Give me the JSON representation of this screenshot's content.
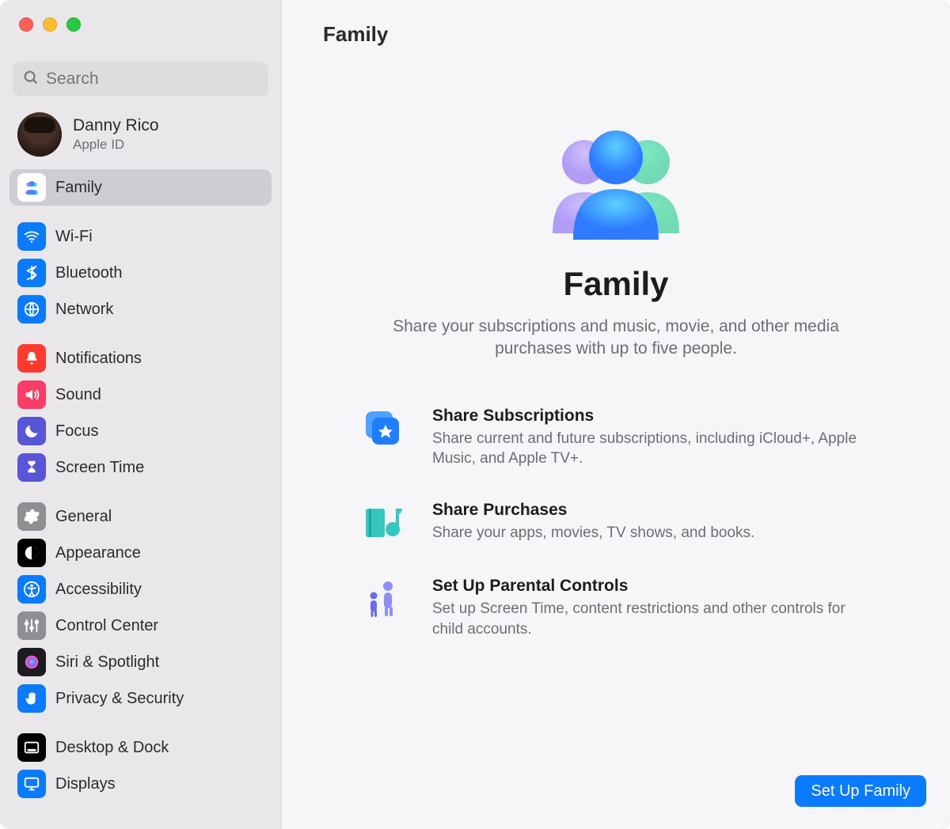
{
  "window": {
    "title": "Family"
  },
  "search": {
    "placeholder": "Search"
  },
  "account": {
    "name": "Danny Rico",
    "subtitle": "Apple ID"
  },
  "sidebar": {
    "items": [
      {
        "id": "family",
        "label": "Family",
        "selected": true,
        "icon": "family",
        "bg": "#ffffff",
        "fg": "#6aa8ff"
      },
      {
        "gap": true
      },
      {
        "id": "wifi",
        "label": "Wi-Fi",
        "icon": "wifi",
        "bg": "#0a7aff",
        "fg": "#ffffff"
      },
      {
        "id": "bluetooth",
        "label": "Bluetooth",
        "icon": "bluetooth",
        "bg": "#0a7aff",
        "fg": "#ffffff"
      },
      {
        "id": "network",
        "label": "Network",
        "icon": "globe",
        "bg": "#0a7aff",
        "fg": "#ffffff"
      },
      {
        "gap": true
      },
      {
        "id": "notifications",
        "label": "Notifications",
        "icon": "bell",
        "bg": "#ff3b30",
        "fg": "#ffffff"
      },
      {
        "id": "sound",
        "label": "Sound",
        "icon": "speaker",
        "bg": "#ff3b68",
        "fg": "#ffffff"
      },
      {
        "id": "focus",
        "label": "Focus",
        "icon": "moon",
        "bg": "#5856d6",
        "fg": "#ffffff"
      },
      {
        "id": "screentime",
        "label": "Screen Time",
        "icon": "hourglass",
        "bg": "#5856d6",
        "fg": "#ffffff"
      },
      {
        "gap": true
      },
      {
        "id": "general",
        "label": "General",
        "icon": "gear",
        "bg": "#8e8e93",
        "fg": "#ffffff"
      },
      {
        "id": "appearance",
        "label": "Appearance",
        "icon": "appearance",
        "bg": "#000000",
        "fg": "#ffffff"
      },
      {
        "id": "accessibility",
        "label": "Accessibility",
        "icon": "accessibility",
        "bg": "#0a7aff",
        "fg": "#ffffff"
      },
      {
        "id": "controlcenter",
        "label": "Control Center",
        "icon": "sliders",
        "bg": "#8e8e93",
        "fg": "#ffffff"
      },
      {
        "id": "siri",
        "label": "Siri & Spotlight",
        "icon": "siri",
        "bg": "#1c1c1e",
        "fg": "#ffffff"
      },
      {
        "id": "privacy",
        "label": "Privacy & Security",
        "icon": "hand",
        "bg": "#0a7aff",
        "fg": "#ffffff"
      },
      {
        "gap": true
      },
      {
        "id": "desktopdock",
        "label": "Desktop & Dock",
        "icon": "dock",
        "bg": "#000000",
        "fg": "#ffffff"
      },
      {
        "id": "displays",
        "label": "Displays",
        "icon": "display",
        "bg": "#0a7aff",
        "fg": "#ffffff"
      }
    ]
  },
  "main": {
    "heroTitle": "Family",
    "heroSubtitle": "Share your subscriptions and music, movie, and other media purchases with up to five people.",
    "features": [
      {
        "id": "subs",
        "title": "Share Subscriptions",
        "desc": "Share current and future subscriptions, including iCloud+, Apple Music, and Apple TV+."
      },
      {
        "id": "purchases",
        "title": "Share Purchases",
        "desc": "Share your apps, movies, TV shows, and books."
      },
      {
        "id": "parental",
        "title": "Set Up Parental Controls",
        "desc": "Set up Screen Time, content restrictions and other controls for child accounts."
      }
    ],
    "cta": "Set Up Family"
  }
}
